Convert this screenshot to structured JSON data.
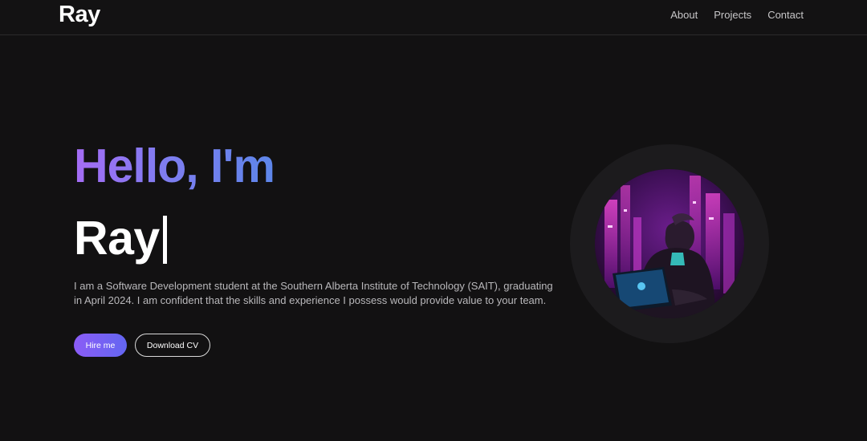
{
  "brand": {
    "logo": "Ray"
  },
  "nav": {
    "items": [
      "About",
      "Projects",
      "Contact"
    ]
  },
  "hero": {
    "greeting": "Hello, I'm",
    "name": "Ray",
    "bio": "I am a Software Development student at the Southern Alberta Institute of Technology (SAIT), graduating in April 2024. I am confident that the skills and experience I possess would provide value to your team.",
    "primary_button": "Hire me",
    "secondary_button": "Download CV"
  },
  "colors": {
    "background": "#121112",
    "accent_start": "#a56cf5",
    "accent_end": "#5d86ea"
  },
  "avatar": {
    "icon": "avatar-image"
  }
}
